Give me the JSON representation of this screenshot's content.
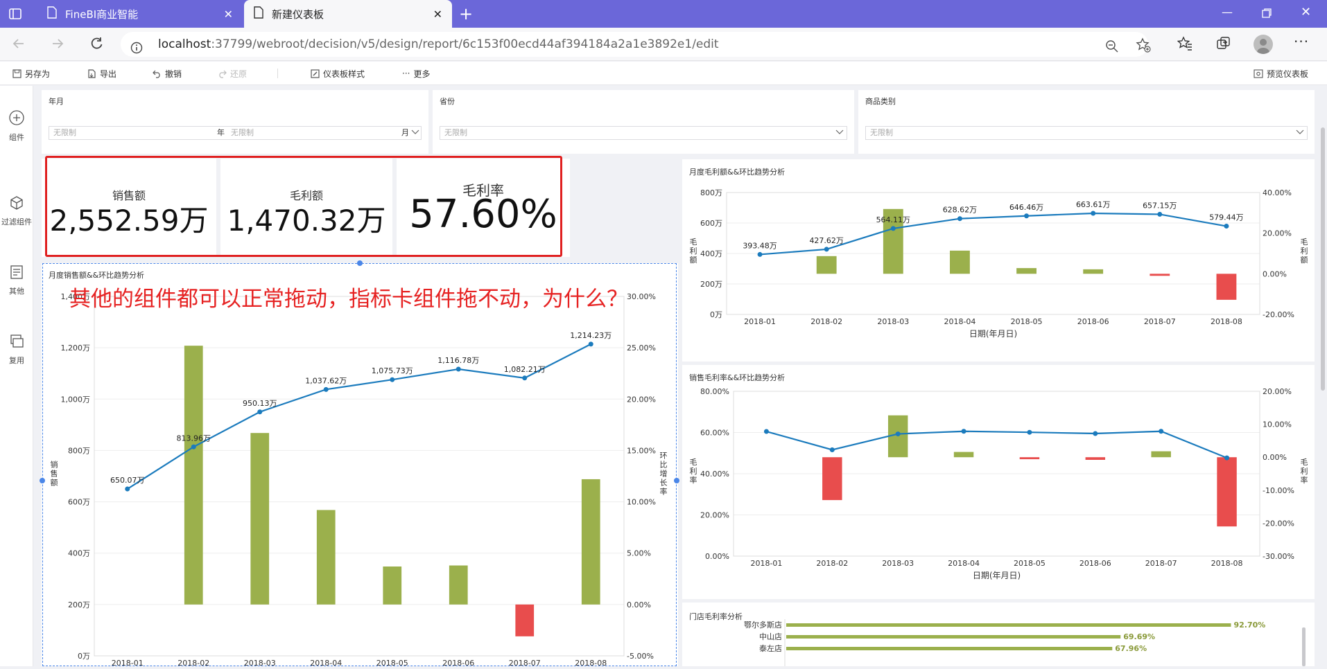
{
  "browser": {
    "tabs": [
      {
        "title": "FineBI商业智能"
      },
      {
        "title": "新建仪表板"
      }
    ],
    "url": {
      "host": "localhost",
      "rest": ":37799/webroot/decision/v5/design/report/6c153f00ecd44af394184a2a1e3892e1/edit"
    }
  },
  "toolbar": {
    "save_as": "另存为",
    "export": "导出",
    "undo": "撤销",
    "redo": "还原",
    "dashboard_style": "仪表板样式",
    "more": "更多",
    "preview": "预览仪表板"
  },
  "sidebar": {
    "items": [
      {
        "label": "组件"
      },
      {
        "label": "过滤组件"
      },
      {
        "label": "其他"
      },
      {
        "label": "复用"
      }
    ]
  },
  "filters": {
    "year_month": {
      "title": "年月",
      "placeholder": "无限制",
      "year_unit": "年",
      "month_unit": "月"
    },
    "province": {
      "title": "省份",
      "placeholder": "无限制"
    },
    "category": {
      "title": "商品类别",
      "placeholder": "无限制"
    }
  },
  "kpis": [
    {
      "label": "销售额",
      "value": "2,552.59万"
    },
    {
      "label": "毛利额",
      "value": "1,470.32万"
    },
    {
      "label": "毛利率",
      "value": "57.60%"
    }
  ],
  "annotation": "其他的组件都可以正常拖动，指标卡组件拖不动，为什么？",
  "colors": {
    "bar": "#9bb04c",
    "bar_negative": "#e84d4d",
    "line": "#1b7bbd",
    "annotation": "#e62222",
    "kpi_border": "#e02020",
    "tab_bar": "#6b67d9"
  },
  "chart_data": [
    {
      "id": "sales",
      "type": "bar",
      "title": "月度销售额&&环比趋势分析",
      "ylabel": "销售额",
      "y2label": "环比增长率",
      "ylim": [
        0,
        1400
      ],
      "y2lim": [
        -5,
        30
      ],
      "yticks": [
        "0万",
        "200万",
        "400万",
        "600万",
        "800万",
        "1,000万",
        "1,200万",
        "1,400万"
      ],
      "y2ticks": [
        "-5.00%",
        "0.00%",
        "5.00%",
        "10.00%",
        "15.00%",
        "20.00%",
        "25.00%",
        "30.00%"
      ],
      "categories": [
        "2018-01",
        "2018-02",
        "2018-03",
        "2018-04",
        "2018-05",
        "2018-06",
        "2018-07",
        "2018-08"
      ],
      "line": {
        "values": [
          650.07,
          813.96,
          950.13,
          1037.62,
          1075.73,
          1116.78,
          1082.21,
          1214.23
        ],
        "labels": [
          "650.07万",
          "813.96万",
          "950.13万",
          "1,037.62万",
          "1,075.73万",
          "1,116.78万",
          "1,082.21万",
          "1,214.23万"
        ]
      },
      "bars": {
        "values": [
          null,
          25.2,
          16.7,
          9.2,
          3.7,
          3.8,
          -3.1,
          12.2
        ]
      }
    },
    {
      "id": "profit",
      "type": "bar",
      "title": "月度毛利额&&环比趋势分析",
      "ylabel": "毛利额",
      "y2label": "毛利额",
      "ylim": [
        0,
        800
      ],
      "y2lim": [
        -20,
        40
      ],
      "yticks": [
        "0万",
        "200万",
        "400万",
        "600万",
        "800万"
      ],
      "y2ticks": [
        "-20.00%",
        "0.00%",
        "20.00%",
        "40.00%"
      ],
      "xlabel": "日期(年月日)",
      "categories": [
        "2018-01",
        "2018-02",
        "2018-03",
        "2018-04",
        "2018-05",
        "2018-06",
        "2018-07",
        "2018-08"
      ],
      "line": {
        "values": [
          393.48,
          427.62,
          564.11,
          628.62,
          646.46,
          663.61,
          657.15,
          579.44
        ],
        "labels": [
          "393.48万",
          "427.62万",
          "564.11万",
          "628.62万",
          "646.46万",
          "663.61万",
          "657.15万",
          "579.44万"
        ]
      },
      "bars": {
        "values": [
          null,
          8.7,
          31.9,
          11.4,
          2.8,
          2.2,
          -1.0,
          -12.8
        ]
      }
    },
    {
      "id": "margin",
      "type": "bar",
      "title": "销售毛利率&&环比趋势分析",
      "ylabel": "毛利率",
      "y2label": "毛利率",
      "ylim": [
        0,
        80
      ],
      "y2lim": [
        -30,
        20
      ],
      "yticks": [
        "0.00%",
        "20.00%",
        "40.00%",
        "60.00%",
        "80.00%"
      ],
      "y2ticks": [
        "-30.00%",
        "-20.00%",
        "-10.00%",
        "0.00%",
        "10.00%",
        "20.00%"
      ],
      "xlabel": "日期(年月日)",
      "categories": [
        "2018-01",
        "2018-02",
        "2018-03",
        "2018-04",
        "2018-05",
        "2018-06",
        "2018-07",
        "2018-08"
      ],
      "line": {
        "values": [
          60.5,
          51.6,
          59.3,
          60.6,
          60.1,
          59.5,
          60.6,
          47.7
        ]
      },
      "bars": {
        "values": [
          null,
          -13.0,
          12.7,
          1.6,
          -0.6,
          -0.8,
          1.8,
          -21.0
        ]
      }
    },
    {
      "id": "stores",
      "type": "bar",
      "title": "门店毛利率分析",
      "categories": [
        "鄂尔多斯店",
        "中山店",
        "泰左店"
      ],
      "values": [
        92.7,
        69.69,
        67.96
      ],
      "labels": [
        "92.70%",
        "69.69%",
        "67.96%"
      ],
      "xlim": [
        0,
        100
      ]
    }
  ]
}
